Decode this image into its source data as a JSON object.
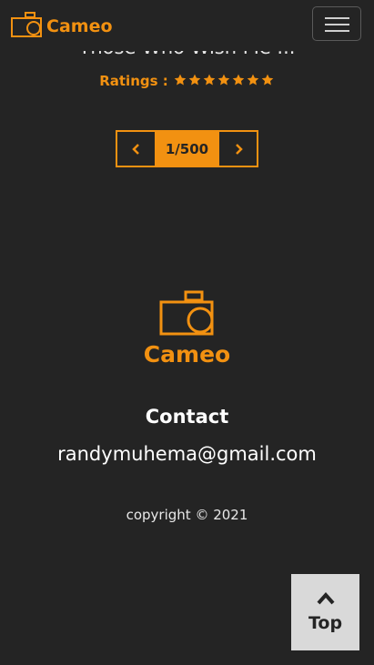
{
  "header": {
    "brand": "Cameo",
    "logo_icon": "camera-icon",
    "menu_icon": "hamburger-menu-icon"
  },
  "item": {
    "title_partial": "Those Who Wish Me ...",
    "ratings_label": "Ratings :",
    "rating_stars": 7,
    "star_icon": "star-icon"
  },
  "pager": {
    "prev_icon": "chevron-left-icon",
    "count": "1/500",
    "next_icon": "chevron-right-icon"
  },
  "footer": {
    "brand": "Cameo",
    "contact_heading": "Contact",
    "contact_email": "randymuhema@gmail.com",
    "copyright": "copyright © 2021"
  },
  "back_to_top": {
    "icon": "chevron-up-icon",
    "label": "Top"
  },
  "colors": {
    "background": "#242424",
    "accent": "#f29111",
    "top_button": "#d9d9d9"
  }
}
